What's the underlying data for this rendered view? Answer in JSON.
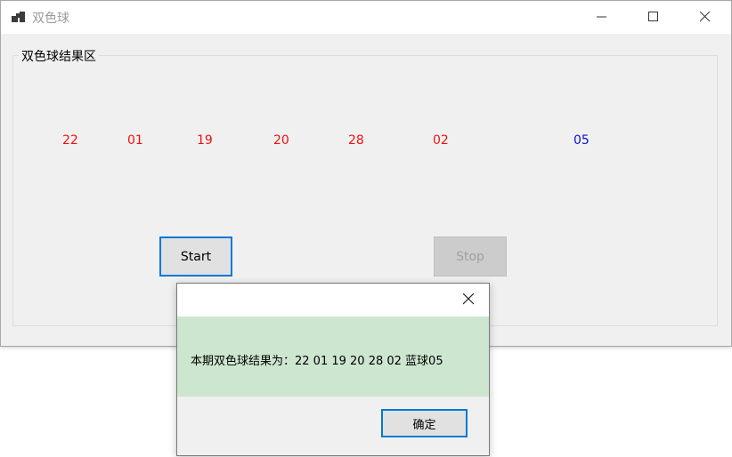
{
  "window": {
    "title": "双色球",
    "group_label": "双色球结果区"
  },
  "balls": {
    "red": [
      "22",
      "01",
      "19",
      "20",
      "28",
      "02"
    ],
    "blue": "05"
  },
  "buttons": {
    "start": "Start",
    "stop": "Stop"
  },
  "dialog": {
    "message": "本期双色球结果为：22 01 19 20 28 02  蓝球05",
    "ok": "确定"
  },
  "colors": {
    "red_ball": "#ee1111",
    "blue_ball": "#1111cc",
    "focus_border": "#0078d7",
    "message_background": "#cde6d0"
  },
  "icons": {
    "app": "app-icon",
    "minimize": "minimize-icon",
    "maximize": "maximize-icon",
    "close": "close-icon"
  }
}
